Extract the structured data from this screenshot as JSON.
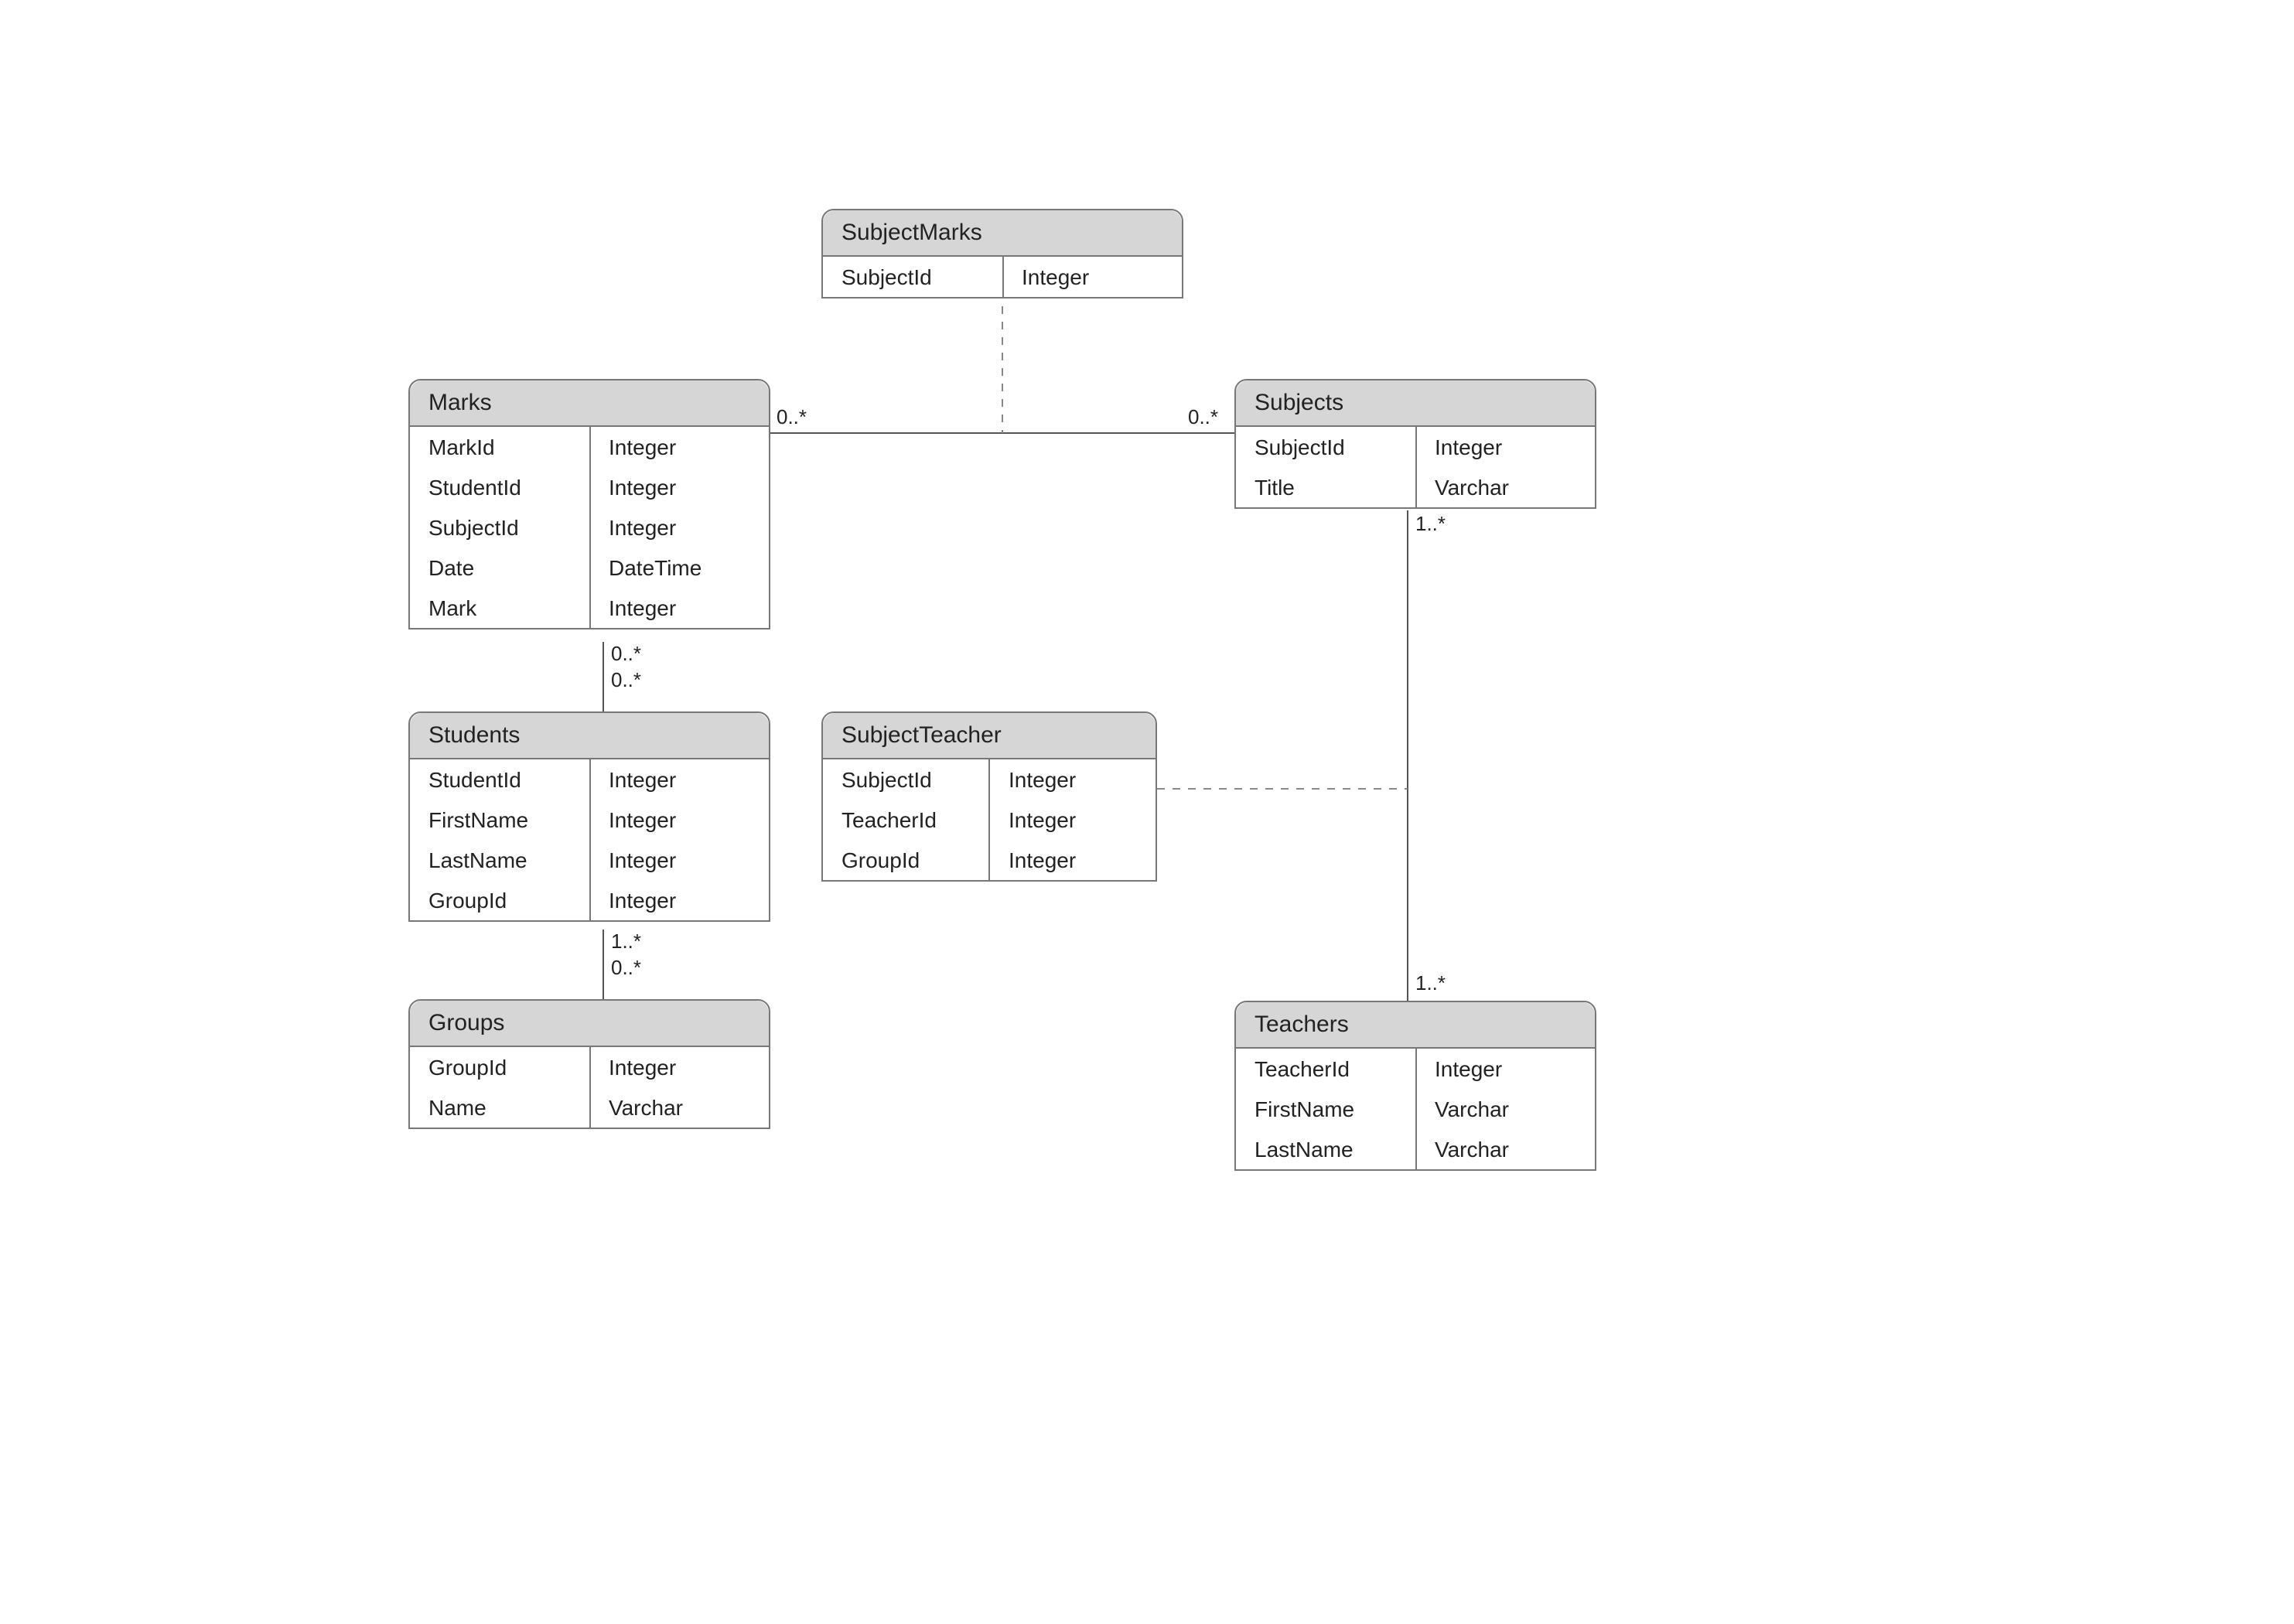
{
  "entities": {
    "subjectMarks": {
      "title": "SubjectMarks",
      "rows": [
        {
          "name": "SubjectId",
          "type": "Integer"
        }
      ]
    },
    "marks": {
      "title": "Marks",
      "rows": [
        {
          "name": "MarkId",
          "type": "Integer"
        },
        {
          "name": "StudentId",
          "type": "Integer"
        },
        {
          "name": "SubjectId",
          "type": "Integer"
        },
        {
          "name": "Date",
          "type": "DateTime"
        },
        {
          "name": "Mark",
          "type": "Integer"
        }
      ]
    },
    "subjects": {
      "title": "Subjects",
      "rows": [
        {
          "name": "SubjectId",
          "type": "Integer"
        },
        {
          "name": "Title",
          "type": "Varchar"
        }
      ]
    },
    "students": {
      "title": "Students",
      "rows": [
        {
          "name": "StudentId",
          "type": "Integer"
        },
        {
          "name": "FirstName",
          "type": "Integer"
        },
        {
          "name": "LastName",
          "type": "Integer"
        },
        {
          "name": "GroupId",
          "type": "Integer"
        }
      ]
    },
    "subjectTeacher": {
      "title": "SubjectTeacher",
      "rows": [
        {
          "name": "SubjectId",
          "type": "Integer"
        },
        {
          "name": "TeacherId",
          "type": "Integer"
        },
        {
          "name": "GroupId",
          "type": "Integer"
        }
      ]
    },
    "groups": {
      "title": "Groups",
      "rows": [
        {
          "name": "GroupId",
          "type": "Integer"
        },
        {
          "name": "Name",
          "type": "Varchar"
        }
      ]
    },
    "teachers": {
      "title": "Teachers",
      "rows": [
        {
          "name": "TeacherId",
          "type": "Integer"
        },
        {
          "name": "FirstName",
          "type": "Varchar"
        },
        {
          "name": "LastName",
          "type": "Varchar"
        }
      ]
    }
  },
  "multiplicities": {
    "marksSubjects_left": "0..*",
    "marksSubjects_right": "0..*",
    "marksStudents_top": "0..*",
    "marksStudents_bottom": "0..*",
    "studentsGroups_top": "1..*",
    "studentsGroups_bottom": "0..*",
    "subjectsTeachers_top": "1..*",
    "subjectsTeachers_bottom": "1..*"
  }
}
